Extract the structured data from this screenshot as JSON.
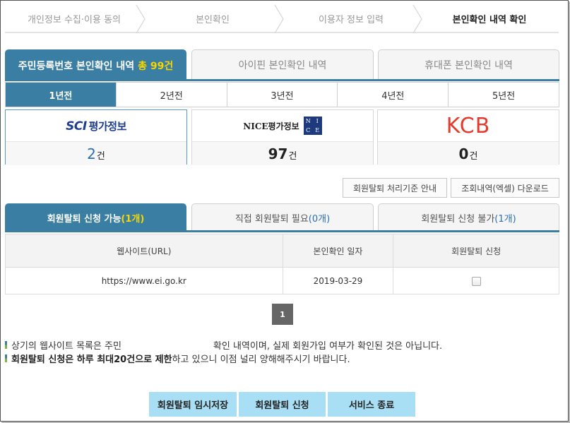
{
  "steps": [
    {
      "label": "개인정보 수집·이용 동의"
    },
    {
      "label": "본인확인"
    },
    {
      "label": "이용자 정보 입력"
    },
    {
      "label": "본인확인 내역 확인"
    }
  ],
  "main_tabs": {
    "resident": {
      "label": "주민등록번호 본인확인 내역",
      "count": "총 99건"
    },
    "ipin": {
      "label": "아이핀 본인확인 내역"
    },
    "phone": {
      "label": "휴대폰 본인확인 내역"
    }
  },
  "year_tabs": [
    "1년전",
    "2년전",
    "3년전",
    "4년전",
    "5년전"
  ],
  "agencies": {
    "sci": {
      "logo_main": "SCI",
      "logo_sub": "평가정보",
      "count": "2",
      "unit": "건"
    },
    "nice": {
      "logo_main": "NICE평가정보",
      "count": "97",
      "unit": "건"
    },
    "kcb": {
      "logo_main": "KCB",
      "count": "0",
      "unit": "건"
    }
  },
  "actions": {
    "criteria_label": "회원탈퇴 처리기준 안내",
    "download_label": "조회내역(엑셀) 다운로드"
  },
  "withdraw_tabs": {
    "possible": {
      "label": "회원탈퇴 신청 가능",
      "count": "(1개)"
    },
    "direct": {
      "label": "직접 회원탈퇴 필요",
      "count": "(0개)"
    },
    "impossible": {
      "label": "회원탈퇴 신청 불가",
      "count": "(1개)"
    }
  },
  "table": {
    "headers": [
      "웹사이트(URL)",
      "본인확인 일자",
      "회원탈퇴 신청"
    ],
    "rows": [
      {
        "url": "https://www.ei.go.kr",
        "date": "2019-03-29"
      }
    ]
  },
  "pagination": {
    "current": "1"
  },
  "notes": {
    "line1_a": "상기의 웹사이트 목록은 주민",
    "line1_b": "확인 내역이며, 실제 회원가입 여부가 확인된 것은 아닙니다.",
    "line2_bold1": "회원탈퇴 신청은 하루 최대 ",
    "line2_bold2": "20건",
    "line2_bold3": "으로 제한",
    "line2_rest": "하고 있으니 이점 널리 양해해주시기 바랍니다."
  },
  "bottom_buttons": {
    "save": "회원탈퇴 임시저장",
    "apply": "회원탈퇴 신청",
    "end": "서비스 종료"
  },
  "colors": {
    "accent": "#3a7ea3",
    "highlight": "#f7d600",
    "button": "#a9dff5",
    "kcb": "#e23b2e"
  }
}
